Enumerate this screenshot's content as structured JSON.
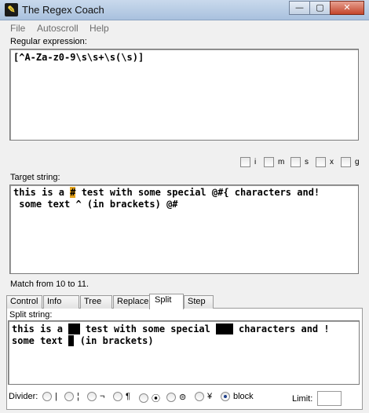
{
  "window": {
    "title": "The Regex Coach",
    "icon": "regex-coach-icon"
  },
  "title_buttons": {
    "minimize": "—",
    "maximize": "▢",
    "close": "✕"
  },
  "menu": [
    "File",
    "Autoscroll",
    "Help"
  ],
  "regex": {
    "label": "Regular expression:",
    "value": "[^A-Za-z0-9\\s\\s+\\s(\\s)]"
  },
  "flags": [
    {
      "name": "i",
      "checked": false
    },
    {
      "name": "m",
      "checked": false
    },
    {
      "name": "s",
      "checked": false
    },
    {
      "name": "x",
      "checked": false
    },
    {
      "name": "g",
      "checked": false
    }
  ],
  "target": {
    "label": "Target string:",
    "line1_before": "this is a ",
    "line1_match": "#",
    "line1_after": " test with some special @#{ characters and!",
    "line2": " some text ^ (in brackets) @#"
  },
  "match_status": "Match from 10 to 11.",
  "tabs": [
    "Control",
    "Info",
    "Tree",
    "Replace",
    "Split",
    "Step"
  ],
  "active_tab": "Split",
  "split": {
    "label": "Split string:",
    "line1_a": "this is a ",
    "line1_b": " test with some special ",
    "line1_c": " characters and !",
    "line2_a": "some text ",
    "line2_b": " (in brackets)"
  },
  "divider": {
    "label": "Divider:",
    "options": [
      "|",
      "¦",
      "¬",
      "¶",
      "⦿",
      "⊜",
      "¥",
      "block"
    ],
    "selected": "block"
  },
  "limit": {
    "label": "Limit:",
    "value": ""
  }
}
